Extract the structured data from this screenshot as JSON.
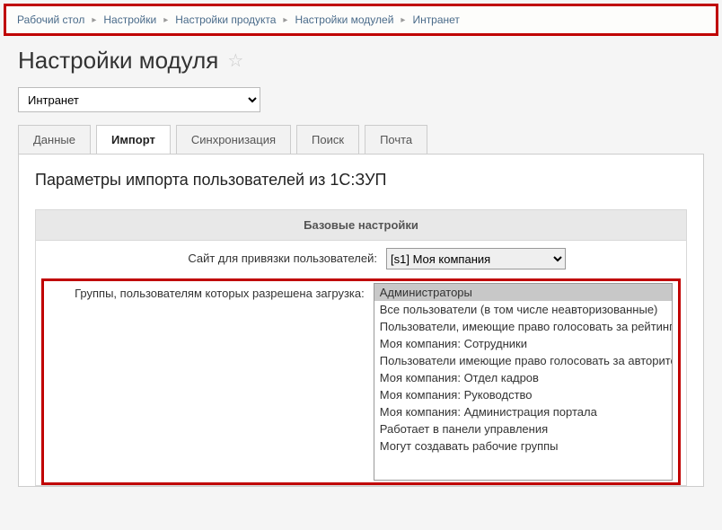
{
  "breadcrumb": {
    "items": [
      {
        "label": "Рабочий стол"
      },
      {
        "label": "Настройки"
      },
      {
        "label": "Настройки продукта"
      },
      {
        "label": "Настройки модулей"
      },
      {
        "label": "Интранет"
      }
    ]
  },
  "page_title": "Настройки модуля",
  "module_select": {
    "selected": "Интранет"
  },
  "tabs": [
    {
      "label": "Данные",
      "active": false
    },
    {
      "label": "Импорт",
      "active": true
    },
    {
      "label": "Синхронизация",
      "active": false
    },
    {
      "label": "Поиск",
      "active": false
    },
    {
      "label": "Почта",
      "active": false
    }
  ],
  "import": {
    "heading": "Параметры импорта пользователей из 1С:ЗУП",
    "section_title": "Базовые настройки",
    "site_label": "Сайт для привязки пользователей:",
    "site_selected": "[s1] Моя компания",
    "groups_label": "Группы, пользователям которых разрешена загрузка:",
    "groups": [
      {
        "label": "Администраторы",
        "selected": true
      },
      {
        "label": "Все пользователи (в том числе неавторизованные)",
        "selected": false
      },
      {
        "label": "Пользователи, имеющие право голосовать за рейтинг",
        "selected": false
      },
      {
        "label": "Моя компания: Сотрудники",
        "selected": false
      },
      {
        "label": "Пользователи имеющие право голосовать за авторитет",
        "selected": false
      },
      {
        "label": "Моя компания: Отдел кадров",
        "selected": false
      },
      {
        "label": "Моя компания: Руководство",
        "selected": false
      },
      {
        "label": "Моя компания: Администрация портала",
        "selected": false
      },
      {
        "label": "Работает в панели управления",
        "selected": false
      },
      {
        "label": "Могут создавать рабочие группы",
        "selected": false
      }
    ]
  }
}
